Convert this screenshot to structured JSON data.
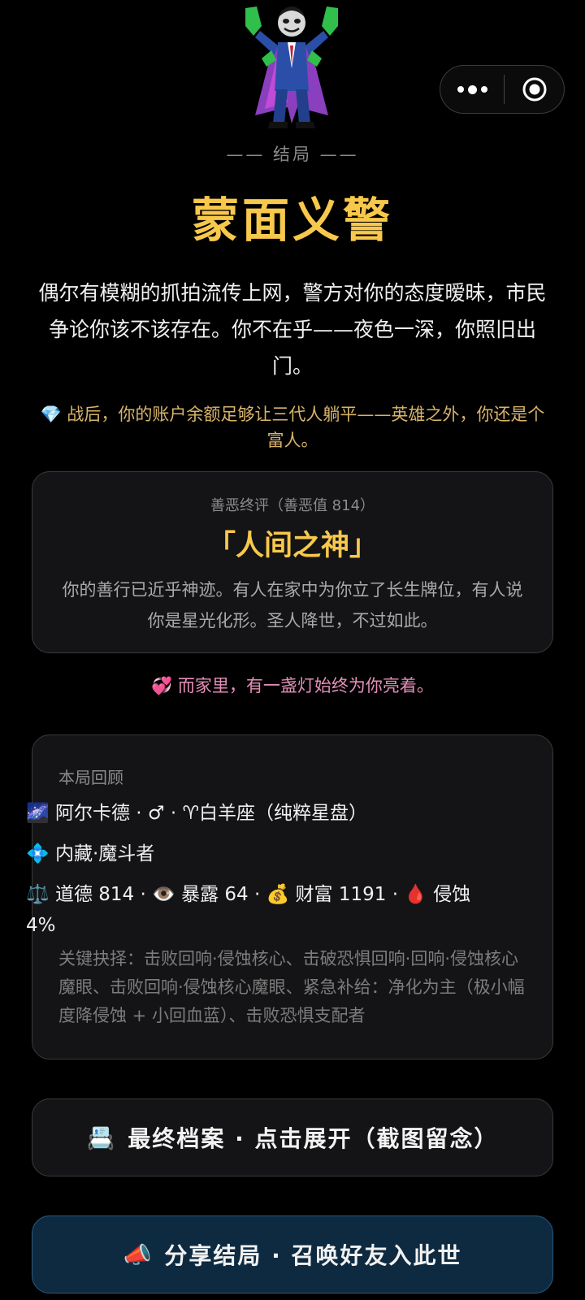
{
  "capsule": {
    "more_icon": "more-dots-icon",
    "close_icon": "target-close-icon"
  },
  "ending": {
    "label": "—— 结局 ——",
    "title": "蒙面义警",
    "description": "偶尔有模糊的抓拍流传上网，警方对你的态度暧昧，市民争论你该不该存在。你不在乎——夜色一深，你照旧出门。",
    "wealth_icon": "💎",
    "wealth_text": "战后，你的账户余额足够让三代人躺平——英雄之外，你还是个富人。"
  },
  "verdict": {
    "subtitle": "善恶终评（善恶值 814）",
    "title": "「人间之神」",
    "text": "你的善行已近乎神迹。有人在家中为你立了长生牌位，有人说你是星光化形。圣人降世，不过如此。"
  },
  "family": {
    "icon": "💞",
    "text": "而家里，有一盏灯始终为你亮着。"
  },
  "recap": {
    "heading": "本局回顾",
    "origin_icon": "🌌",
    "origin": "阿尔卡德 · ♂ · ♈白羊座（纯粹星盘）",
    "core_icon": "💠",
    "core": "内藏·魔斗者",
    "stats": {
      "morality_icon": "⚖️",
      "morality": "道德 814",
      "exposure_icon": "👁️",
      "exposure": "暴露 64",
      "wealth_icon": "💰",
      "wealth": "财富 1191",
      "erosion_icon": "🩸",
      "erosion": "侵蚀 4%"
    },
    "key_choices": "关键抉择：击败回响·侵蚀核心、击破恐惧回响·回响·侵蚀核心魔眼、击败回响·侵蚀核心魔眼、紧急补给：净化为主（极小幅度降侵蚀 + 小回血蓝）、击败恐惧支配者"
  },
  "buttons": {
    "archive_icon": "📇",
    "archive_label": "最终档案 · 点击展开（截图留念）",
    "share_icon": "📣",
    "share_label": "分享结局 · 召唤好友入此世"
  },
  "colors": {
    "gold": "#f7c84b",
    "wealth_text": "#d8b46a",
    "family_pink": "#e58fb8",
    "card_bg": "#141416",
    "share_bg": "#0e2a40"
  }
}
